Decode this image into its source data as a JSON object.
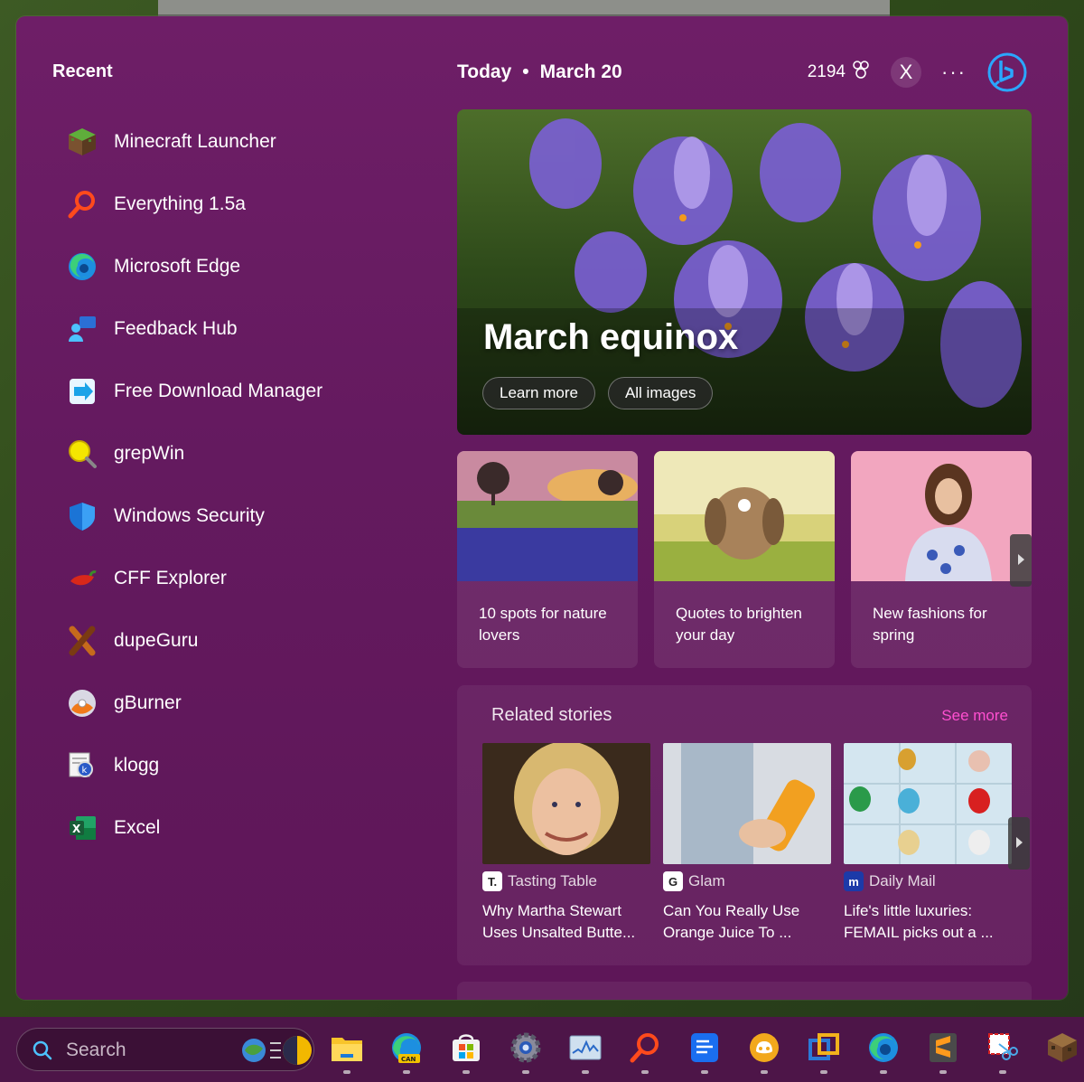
{
  "recent": {
    "title": "Recent",
    "apps": [
      {
        "label": "Minecraft Launcher"
      },
      {
        "label": "Everything 1.5a"
      },
      {
        "label": "Microsoft Edge"
      },
      {
        "label": "Feedback Hub"
      },
      {
        "label": "Free Download Manager"
      },
      {
        "label": "grepWin"
      },
      {
        "label": "Windows Security"
      },
      {
        "label": "CFF Explorer"
      },
      {
        "label": "dupeGuru"
      },
      {
        "label": "gBurner"
      },
      {
        "label": "klogg"
      },
      {
        "label": "Excel"
      }
    ]
  },
  "header": {
    "today": "Today",
    "separator": "•",
    "date": "March 20",
    "points": "2194",
    "avatar_letter": "X",
    "more": "···"
  },
  "hero": {
    "title": "March equinox",
    "learn_more": "Learn more",
    "all_images": "All images"
  },
  "cards": [
    {
      "text": "10 spots for nature lovers"
    },
    {
      "text": "Quotes to brighten your day"
    },
    {
      "text": "New fashions for spring"
    }
  ],
  "related": {
    "title": "Related stories",
    "see_more": "See more",
    "stories": [
      {
        "source": "Tasting Table",
        "source_icon": "T.",
        "title_line1": "Why Martha Stewart",
        "title_line2": "Uses Unsalted Butte..."
      },
      {
        "source": "Glam",
        "source_icon": "G",
        "title_line1": "Can You Really Use",
        "title_line2": "Orange Juice To ..."
      },
      {
        "source": "Daily Mail",
        "source_icon": "m",
        "title_line1": "Life's little luxuries:",
        "title_line2": "FEMAIL picks out a ..."
      }
    ]
  },
  "taskbar": {
    "search_placeholder": "Search"
  },
  "colors": {
    "panel": "#6e1e67",
    "accent_link": "#ff4fd0",
    "taskbar": "#4d1548"
  }
}
